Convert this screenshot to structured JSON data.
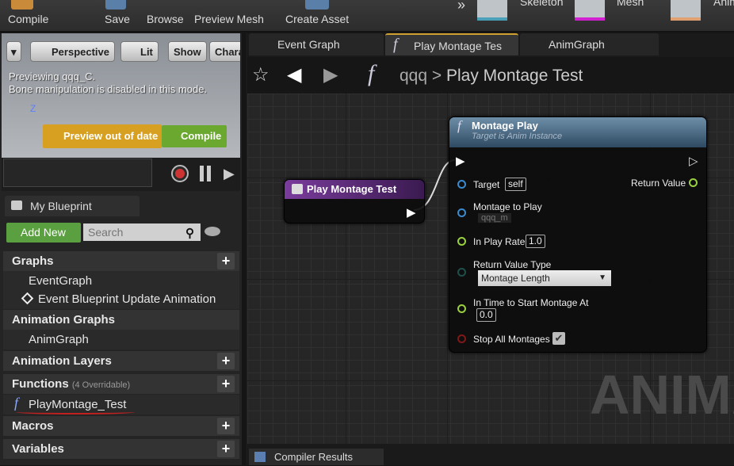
{
  "toolbar": {
    "compile": "Compile",
    "save": "Save",
    "browse": "Browse",
    "preview_mesh": "Preview Mesh",
    "create_asset": "Create Asset",
    "overflow": "»",
    "skeleton": "Skeleton",
    "mesh": "Mesh",
    "anim": "Anim"
  },
  "viewport": {
    "menu_arrow": "▾",
    "perspective": "Perspective",
    "lit": "Lit",
    "show": "Show",
    "character": "Chara",
    "previewing": "Previewing qqq_C.",
    "bone_msg": "Bone manipulation is disabled in this mode.",
    "axis_z": "Z",
    "preview_out_of_date": "Preview out of date",
    "compile": "Compile"
  },
  "my_blueprint": {
    "tab": "My Blueprint",
    "add_new": "Add New",
    "search_placeholder": "Search",
    "graphs": "Graphs",
    "event_graph": "EventGraph",
    "event_update": "Event Blueprint Update Animation",
    "animation_graphs": "Animation Graphs",
    "anim_graph": "AnimGraph",
    "animation_layers": "Animation Layers",
    "functions": "Functions",
    "overridable": "(4 Overridable)",
    "function_item": "PlayMontage_Test",
    "macros": "Macros",
    "variables": "Variables"
  },
  "tabs": [
    {
      "label": "Event Graph"
    },
    {
      "label": "Play Montage Tes"
    },
    {
      "label": "AnimGraph"
    }
  ],
  "breadcrumb": {
    "root": "qqq",
    "separator": ">",
    "current": "Play Montage Test"
  },
  "entry_node": {
    "title": "Play Montage Test",
    "color": "#5a2a7a"
  },
  "montage_node": {
    "title": "Montage Play",
    "subtitle": "Target is Anim Instance",
    "target": "Target",
    "target_value": "self",
    "return_value": "Return Value",
    "montage_to_play": "Montage to Play",
    "montage_value": "qqq_m",
    "play_rate": "In Play Rate",
    "play_rate_value": "1.0",
    "return_type": "Return Value Type",
    "return_type_value": "Montage Length",
    "start_time": "In Time to Start Montage At",
    "start_time_value": "0.0",
    "stop_all": "Stop All Montages",
    "stop_all_checked": true
  },
  "watermark": "ANIMA",
  "compiler_results": "Compiler Results"
}
